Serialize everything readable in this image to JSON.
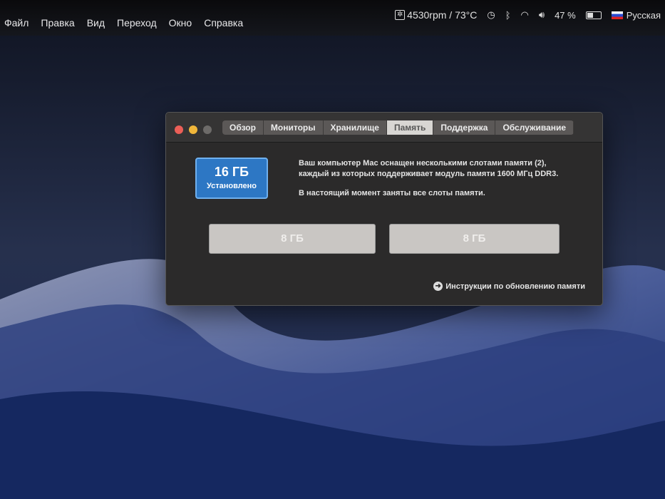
{
  "menubar": {
    "items": [
      "Файл",
      "Правка",
      "Вид",
      "Переход",
      "Окно",
      "Справка"
    ],
    "fan_status": "4530rpm / 73°C",
    "battery": "47 %",
    "battery_percent": 47,
    "input_source": "Русская"
  },
  "window": {
    "tabs": [
      "Обзор",
      "Мониторы",
      "Хранилище",
      "Память",
      "Поддержка",
      "Обслуживание"
    ],
    "active_tab": "Память",
    "memory_total": "16 ГБ",
    "memory_label": "Установлено",
    "desc_line1": "Ваш компьютер Mac оснащен несколькими слотами памяти (2),",
    "desc_line2": "каждый из которых поддерживает модуль памяти 1600 МГц DDR3.",
    "desc_line3": "В настоящий момент заняты все слоты памяти.",
    "slots": [
      "8 ГБ",
      "8 ГБ"
    ],
    "upgrade_link": "Инструкции по обновлению памяти"
  }
}
